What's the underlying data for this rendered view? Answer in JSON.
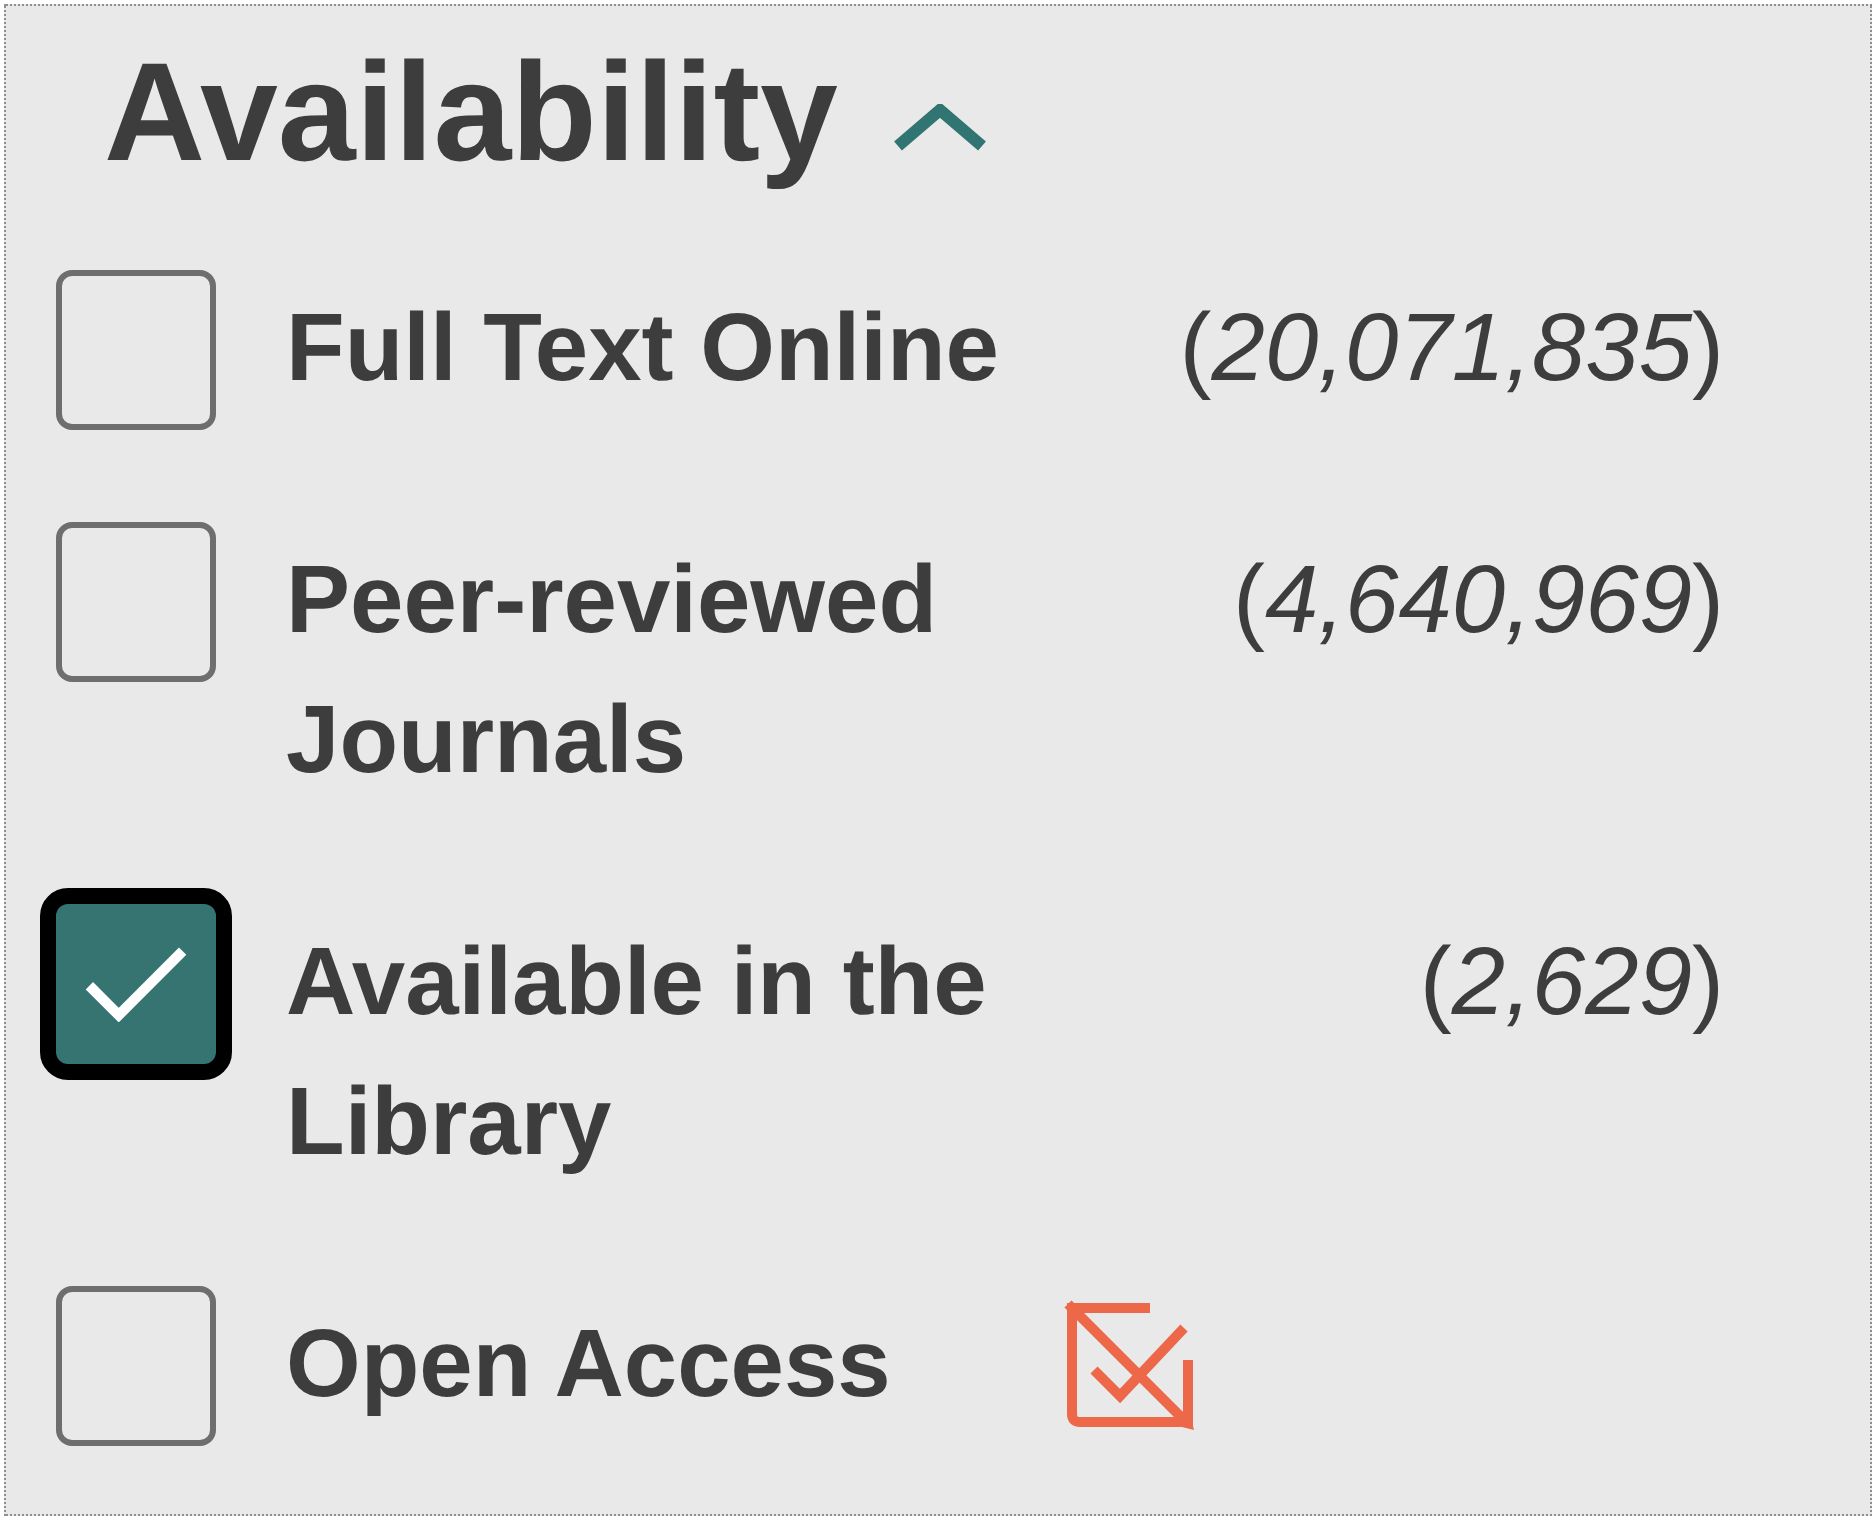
{
  "filter": {
    "title": "Availability",
    "expanded": true
  },
  "items": [
    {
      "kind": "count",
      "label": "Full Text Online",
      "count": "(*20,071,835*)",
      "checked": false,
      "focused": false
    },
    {
      "kind": "count",
      "label": "Peer-reviewed Journals",
      "count": "(*4,640,969*)",
      "checked": false,
      "focused": false
    },
    {
      "kind": "count",
      "label": "Available in the Library",
      "count": "(*2,629*)",
      "checked": true,
      "focused": true
    },
    {
      "kind": "icon",
      "label": "Open Access",
      "checked": false,
      "focused": false
    }
  ]
}
